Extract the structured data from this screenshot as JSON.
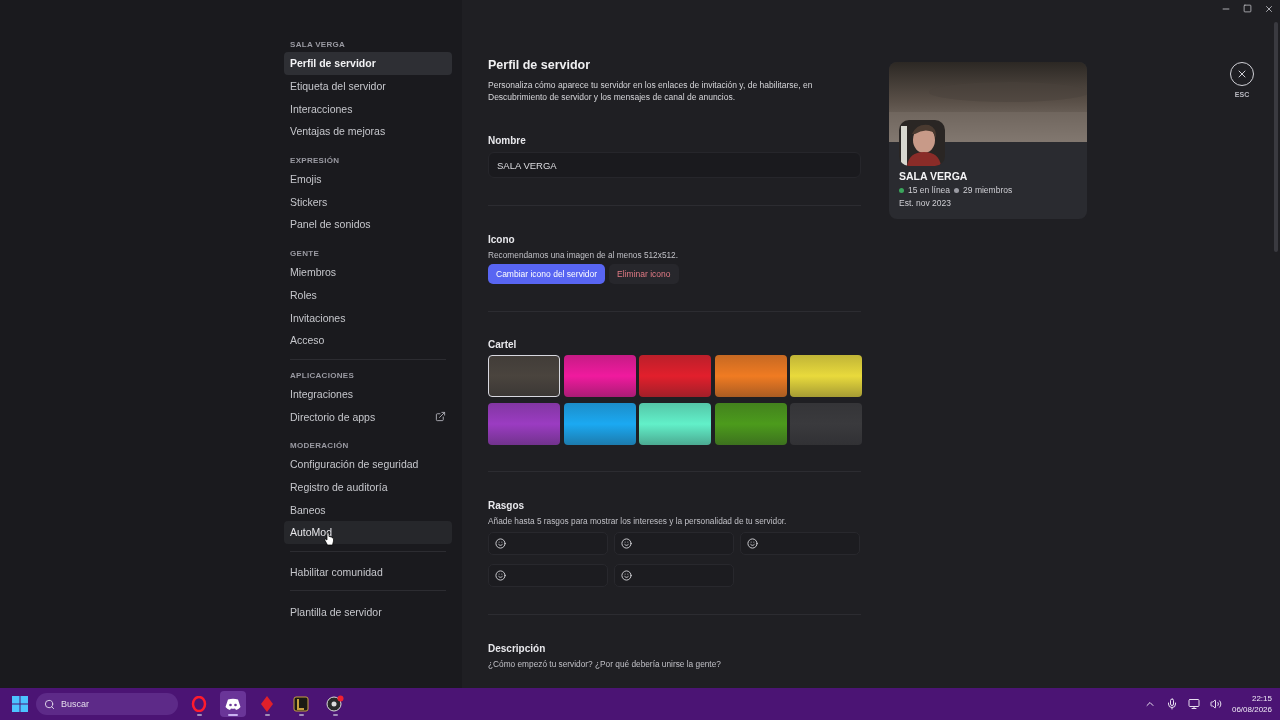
{
  "sidebar": {
    "sections": [
      {
        "header": "SALA VERGA",
        "divided": false,
        "items": [
          {
            "label": "Perfil de servidor",
            "selected": true,
            "hovered": false
          },
          {
            "label": "Etiqueta del servidor",
            "selected": false,
            "hovered": false
          },
          {
            "label": "Interacciones",
            "selected": false,
            "hovered": false
          },
          {
            "label": "Ventajas de mejoras",
            "selected": false,
            "hovered": false
          }
        ]
      },
      {
        "header": "EXPRESIÓN",
        "divided": false,
        "items": [
          {
            "label": "Emojis",
            "selected": false,
            "hovered": false
          },
          {
            "label": "Stickers",
            "selected": false,
            "hovered": false
          },
          {
            "label": "Panel de sonidos",
            "selected": false,
            "hovered": false
          }
        ]
      },
      {
        "header": "GENTE",
        "divided": false,
        "items": [
          {
            "label": "Miembros",
            "selected": false,
            "hovered": false
          },
          {
            "label": "Roles",
            "selected": false,
            "hovered": false
          },
          {
            "label": "Invitaciones",
            "selected": false,
            "hovered": false
          },
          {
            "label": "Acceso",
            "selected": false,
            "hovered": false
          }
        ]
      },
      {
        "header": "APLICACIONES",
        "divided": true,
        "items": [
          {
            "label": "Integraciones",
            "selected": false,
            "hovered": false
          },
          {
            "label": "Directorio de apps",
            "selected": false,
            "hovered": false,
            "external": true
          }
        ]
      },
      {
        "header": "MODERACIÓN",
        "divided": false,
        "items": [
          {
            "label": "Configuración de seguridad",
            "selected": false,
            "hovered": false
          },
          {
            "label": "Registro de auditoría",
            "selected": false,
            "hovered": false
          },
          {
            "label": "Baneos",
            "selected": false,
            "hovered": false
          },
          {
            "label": "AutoMod",
            "selected": false,
            "hovered": true
          }
        ]
      },
      {
        "divided": true,
        "items": [
          {
            "label": "Habilitar comunidad",
            "selected": false,
            "hovered": false
          }
        ]
      },
      {
        "divided": true,
        "items": [
          {
            "label": "Plantilla de servidor",
            "selected": false,
            "hovered": false
          }
        ]
      }
    ]
  },
  "page": {
    "title": "Perfil de servidor",
    "description": "Personaliza cómo aparece tu servidor en los enlaces de invitación y, de habilitarse, en Descubrimiento de servidor y los mensajes de canal de anuncios.",
    "name": {
      "label": "Nombre",
      "value": "SALA VERGA"
    },
    "icon": {
      "label": "Icono",
      "hint": "Recomendamos una imagen de al menos 512x512.",
      "buttons": [
        {
          "label": "Cambiar icono del servidor",
          "kind": "primary"
        },
        {
          "label": "Eliminar icono",
          "kind": "danger"
        }
      ]
    },
    "banner": {
      "label": "Cartel",
      "swatches": [
        {
          "color": "#4a443e",
          "selected": true
        },
        {
          "color": "#f01a9e",
          "selected": false
        },
        {
          "color": "#e21f2c",
          "selected": false
        },
        {
          "color": "#f07b22",
          "selected": false
        },
        {
          "color": "#e9da3c",
          "selected": false
        },
        {
          "color": "#9b3cc2",
          "selected": false
        },
        {
          "color": "#1ba9f2",
          "selected": false
        },
        {
          "color": "#62f0c9",
          "selected": false
        },
        {
          "color": "#4c9b1c",
          "selected": false
        },
        {
          "color": "#3a3a3d",
          "selected": false
        }
      ]
    },
    "traits": {
      "label": "Rasgos",
      "hint": "Añade hasta 5 rasgos para mostrar los intereses y la personalidad de tu servidor.",
      "fields": [
        {
          "kind": "emoji"
        },
        {
          "kind": "emoji"
        },
        {
          "kind": "emoji"
        },
        {
          "kind": "emoji"
        },
        {
          "kind": "emoji"
        }
      ]
    },
    "description_field": {
      "label": "Descripción",
      "hint": "¿Cómo empezó tu servidor? ¿Por qué debería unirse la gente?"
    }
  },
  "preview": {
    "name": "SALA VERGA",
    "online": "15 en línea",
    "members": "29 miembros",
    "established": "Est. nov 2023"
  },
  "close": {
    "label": "ESC"
  },
  "taskbar": {
    "search": "Buscar",
    "apps": [
      {
        "kind": "opera",
        "selected": false
      },
      {
        "kind": "discord",
        "selected": true
      },
      {
        "kind": "red",
        "selected": false
      },
      {
        "kind": "league",
        "selected": false
      },
      {
        "kind": "obs",
        "selected": false
      }
    ],
    "time": "22:15",
    "date": "06/08/2026"
  }
}
